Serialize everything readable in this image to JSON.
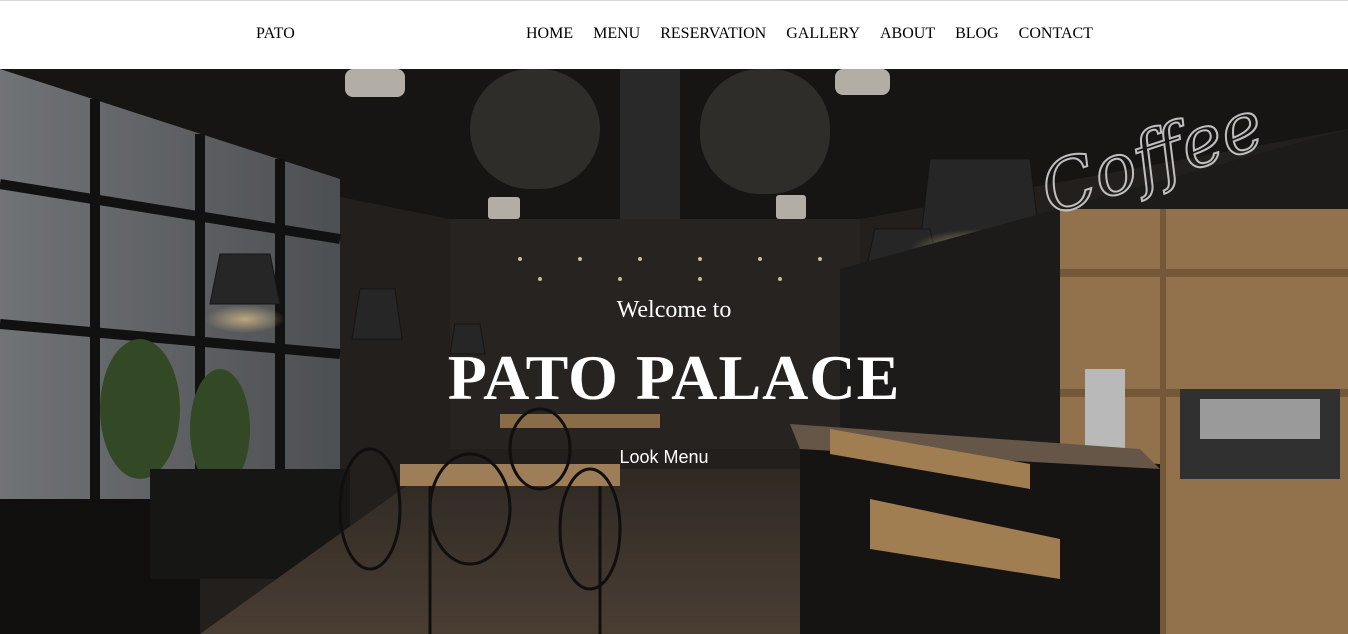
{
  "header": {
    "brand": "PATO",
    "nav": [
      "HOME",
      "MENU",
      "RESERVATION",
      "GALLERY",
      "ABOUT",
      "BLOG",
      "CONTACT"
    ]
  },
  "hero": {
    "welcome": "Welcome to",
    "title": "PATO PALACE",
    "cta": "Look Menu",
    "sign": "Coffee"
  },
  "colors": {
    "header_bg": "#ffffff",
    "hero_text": "#ffffff",
    "wood": "#b38b5d"
  }
}
